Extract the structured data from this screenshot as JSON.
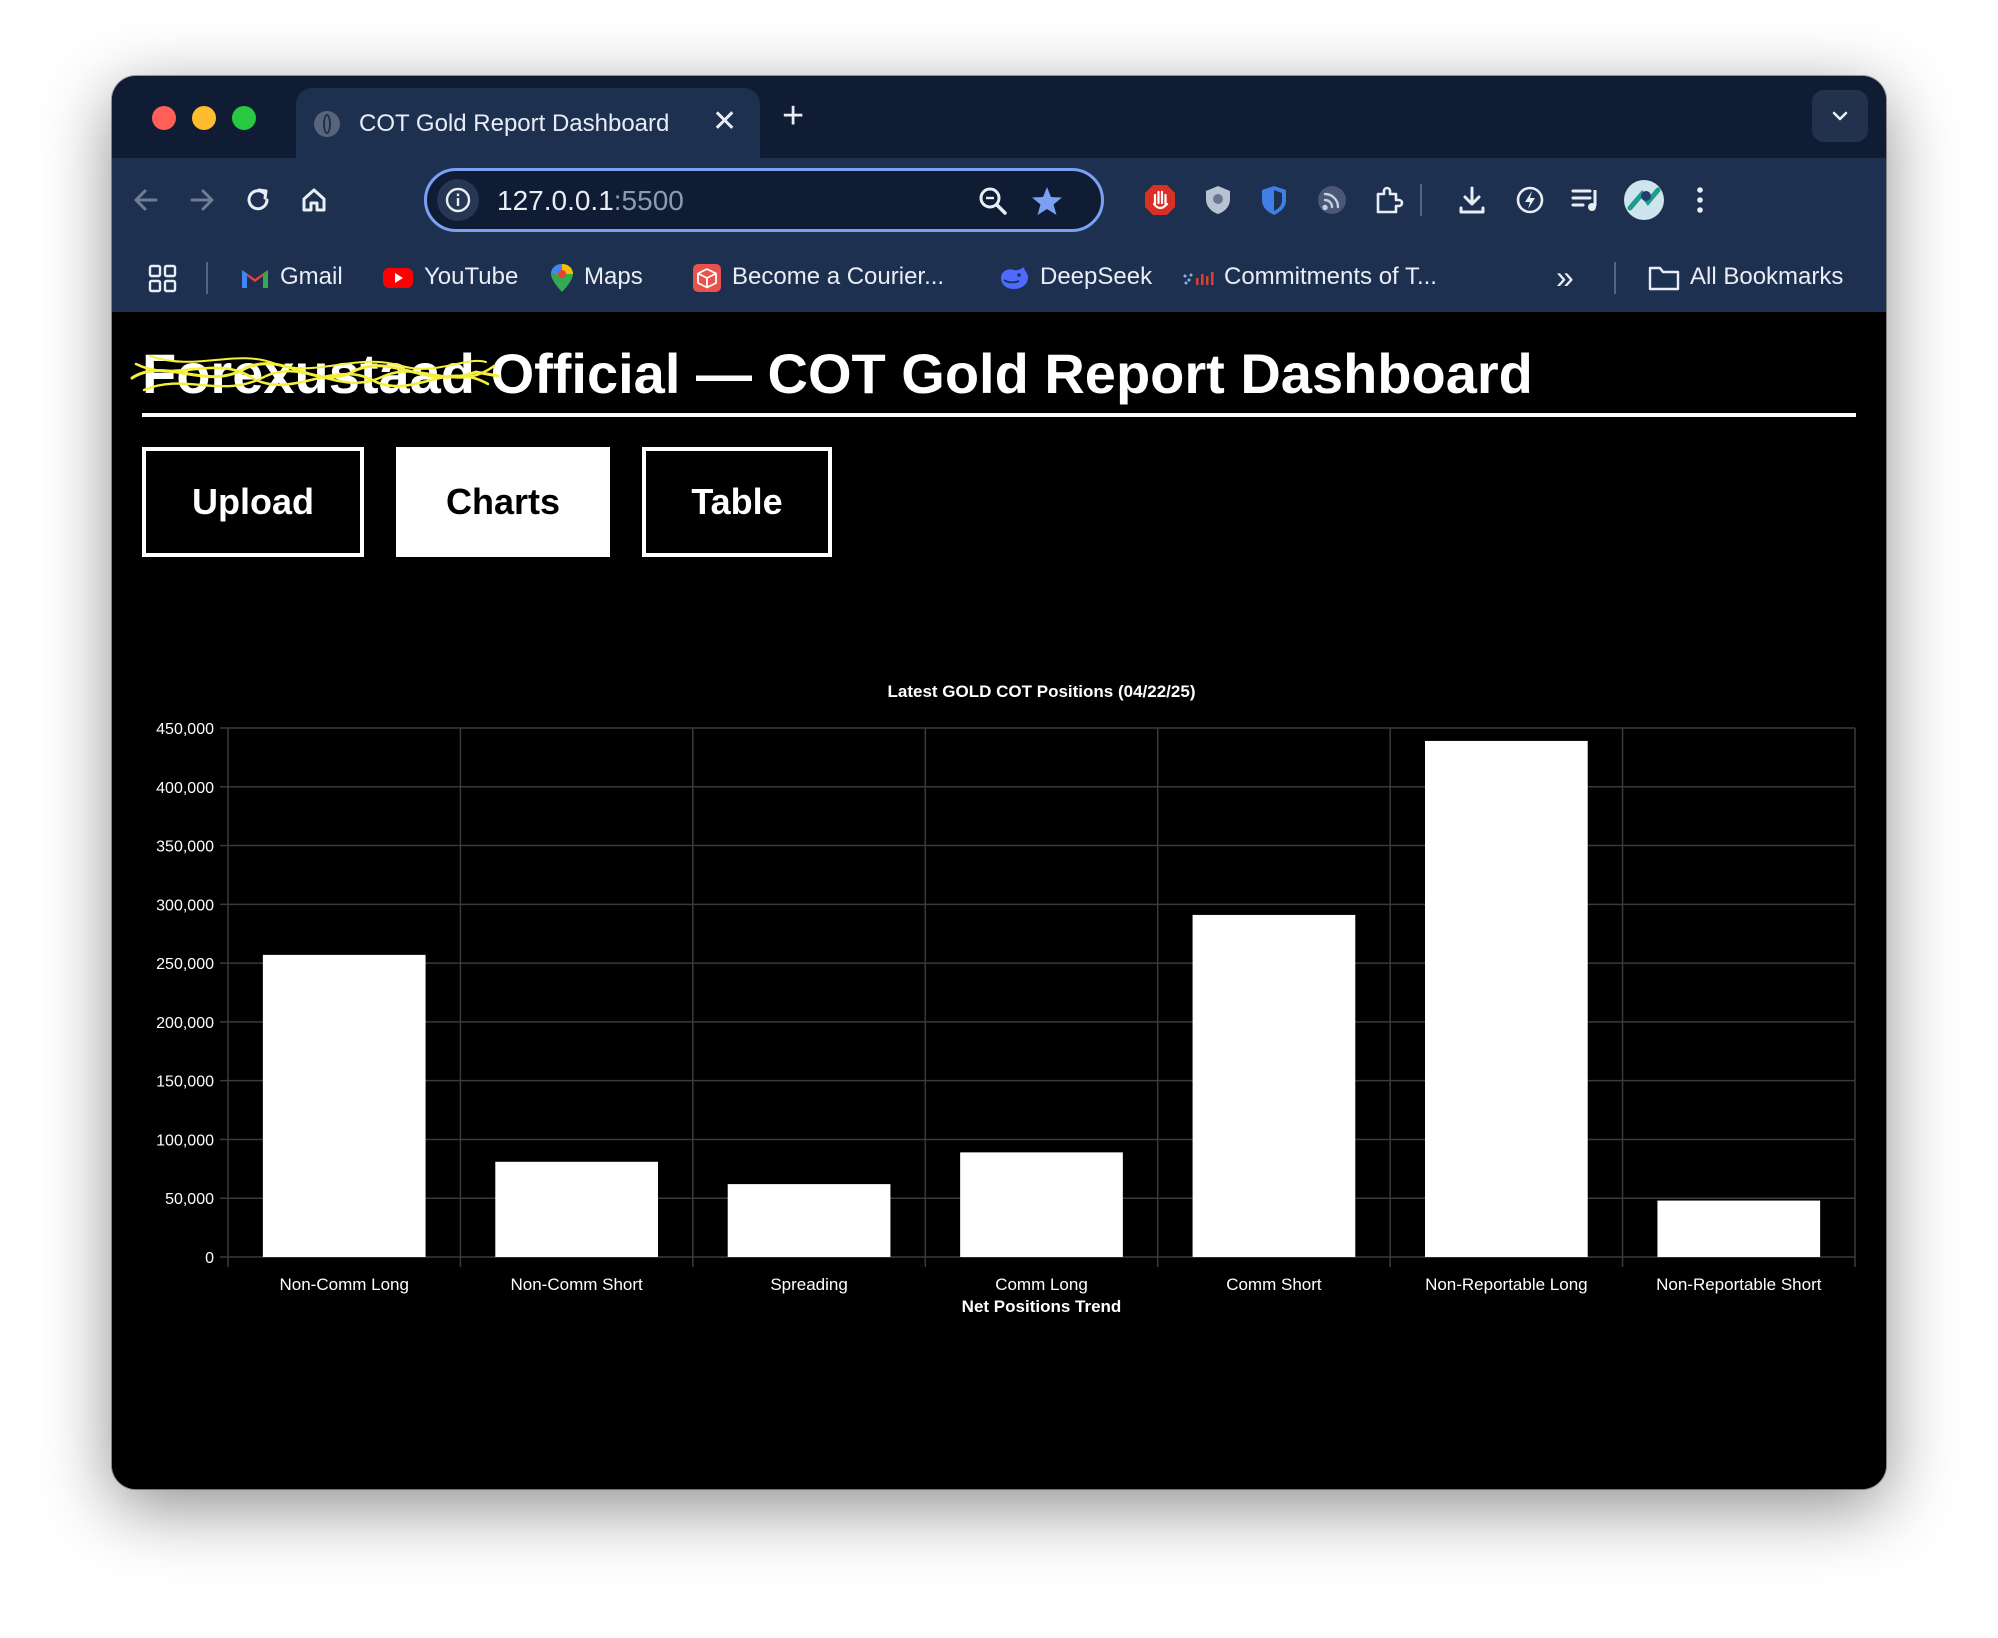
{
  "browser": {
    "tab_title": "COT Gold Report Dashboard",
    "tab_close_glyph": "✕",
    "new_tab_glyph": "+",
    "url_host": "127.0.0.1",
    "url_port": ":5500",
    "traffic_lights": [
      "#fe5f57",
      "#febc2e",
      "#28c840"
    ],
    "bookmarks": [
      {
        "label": "Gmail",
        "icon": "gmail-icon"
      },
      {
        "label": "YouTube",
        "icon": "youtube-icon"
      },
      {
        "label": "Maps",
        "icon": "maps-icon"
      },
      {
        "label": "Become a Courier...",
        "icon": "courier-icon"
      },
      {
        "label": "DeepSeek",
        "icon": "deepseek-icon"
      },
      {
        "label": "Commitments of T...",
        "icon": "cftc-icon"
      }
    ],
    "more_bookmarks_glyph": "»",
    "all_bookmarks": "All Bookmarks"
  },
  "page": {
    "title": "Forexustaad Official — COT Gold Report Dashboard",
    "title_overwritten": "Forexustaad",
    "title_rest": "Official — COT Gold Report Dashboard",
    "scribble_color": "#f5f03c",
    "buttons": [
      {
        "label": "Upload",
        "active": false
      },
      {
        "label": "Charts",
        "active": true
      },
      {
        "label": "Table",
        "active": false
      }
    ]
  },
  "chart_data": {
    "type": "bar",
    "title": "Latest GOLD COT Positions (04/22/25)",
    "categories": [
      "Non-Comm Long",
      "Non-Comm Short",
      "Spreading",
      "Comm Long",
      "Comm Short",
      "Non-Reportable Long",
      "Non-Reportable Short"
    ],
    "values": [
      257000,
      81000,
      62000,
      89000,
      291000,
      439000,
      48000
    ],
    "ylim": [
      0,
      450000
    ],
    "yticks": [
      "0",
      "50,000",
      "100,000",
      "150,000",
      "200,000",
      "250,000",
      "300,000",
      "350,000",
      "400,000",
      "450,000"
    ],
    "ytick_values": [
      0,
      50000,
      100000,
      150000,
      200000,
      250000,
      300000,
      350000,
      400000,
      450000
    ],
    "grid": true,
    "bar_color": "#ffffff",
    "grid_color": "#3a3a3a",
    "next_section_title": "Net Positions Trend"
  }
}
